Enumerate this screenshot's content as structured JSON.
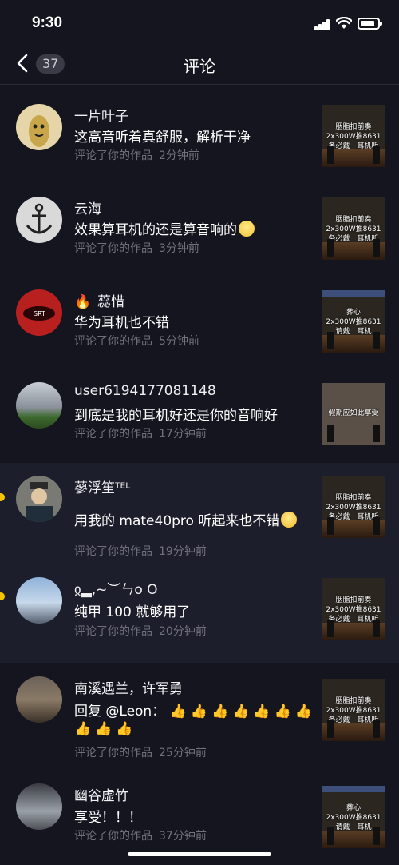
{
  "status": {
    "time": "9:30"
  },
  "nav": {
    "back_count": "37",
    "title": "评论"
  },
  "comments": [
    {
      "user": "一片叶子",
      "text": "这高音听着真舒服，解析干净",
      "action": "评论了你的作品",
      "time": "2分钟前",
      "thumb_caption": "胭脂扣前奏\n2x300W推8631\n务必戴　耳机听"
    },
    {
      "user": "云海",
      "text": "效果算耳机的还是算音响的",
      "action": "评论了你的作品",
      "time": "3分钟前",
      "thumb_caption": "胭脂扣前奏\n2x300W推8631\n务必戴　耳机听"
    },
    {
      "user": "蕊惜",
      "text": "华为耳机也不错",
      "action": "评论了你的作品",
      "time": "5分钟前",
      "thumb_caption": "葬心\n2x300W推8631\n请戴　耳机"
    },
    {
      "user": "user6194177081148",
      "text": "到底是我的耳机好还是你的音响好",
      "action": "评论了你的作品",
      "time": "17分钟前",
      "thumb_caption": "假期应如此享受"
    },
    {
      "user": "蓼浮笙ᵀᴱᴸ",
      "text": "用我的 mate40pro 听起来也不错",
      "action": "评论了你的作品",
      "time": "19分钟前",
      "thumb_caption": "胭脂扣前奏\n2x300W推8631\n务必戴　耳机听"
    },
    {
      "user": "ჲ▂,~︶ㄣo O",
      "text": "纯甲 100 就够用了",
      "action": "评论了你的作品",
      "time": "20分钟前",
      "thumb_caption": "胭脂扣前奏\n2x300W推8631\n务必戴　耳机听"
    },
    {
      "user": "南溪遇兰，许军勇",
      "text": "回复 @Leon：",
      "action": "评论了你的作品",
      "time": "25分钟前",
      "thumb_caption": "胭脂扣前奏\n2x300W推8631\n务必戴　耳机听"
    },
    {
      "user": "幽谷虚竹",
      "text": "享受！！！",
      "action": "评论了你的作品",
      "time": "37分钟前",
      "thumb_caption": "葬心\n2x300W推8631\n请戴　耳机"
    }
  ]
}
